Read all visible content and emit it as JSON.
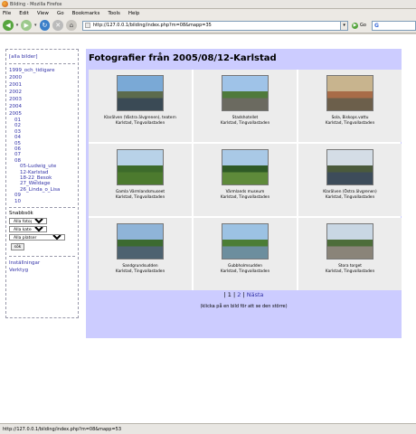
{
  "window": {
    "title": "Bilding - Mozilla Firefox"
  },
  "menu": [
    "File",
    "Edit",
    "View",
    "Go",
    "Bookmarks",
    "Tools",
    "Help"
  ],
  "toolbar": {
    "url": "http://127.0.0.1/bilding/index.php?m=08&mapp=35",
    "go_label": "Go"
  },
  "sidebar": {
    "all_images": "[alla bilder]",
    "years": [
      "1999_och_tidigare",
      "2000",
      "2001",
      "2002",
      "2003",
      "2004",
      "2005"
    ],
    "months": [
      "01",
      "02",
      "03",
      "04",
      "05",
      "06",
      "07",
      "08"
    ],
    "albums": [
      "05-Ludwig_ute",
      "12-Karlstad",
      "18-22_Besok",
      "27_Weldage",
      "26_Linda_o_Lisa"
    ],
    "months_after": [
      "09",
      "10"
    ],
    "quicksearch_label": "Snabbsök",
    "select_photographer": "Alla fotografer",
    "select_category": "Alla kategorier",
    "select_place": "Alla platser",
    "search_button": "sök",
    "settings": "Inställningar",
    "login": "Verktyg"
  },
  "main": {
    "title": "Fotografier från 2005/08/12-Karlstad",
    "photos": [
      {
        "cap1": "Klarälven (Västra älvgrenen), teatern",
        "cap2": "Karlstad, Tingvallastaden",
        "sky": "#7aa9d6",
        "ground": "#3a4a55",
        "mid": "#5c6b4d"
      },
      {
        "cap1": "Stadshotellet",
        "cap2": "Karlstad, Tingvallastaden",
        "sky": "#9fc3e8",
        "ground": "#6b6a60",
        "mid": "#4f7a3b"
      },
      {
        "cap1": "Sola, Biskops.vattu",
        "cap2": "Karlstad, Tingvallastaden",
        "sky": "#c8b48e",
        "ground": "#6c5f4b",
        "mid": "#a86c48"
      },
      {
        "cap1": "Gamla Värmlandsmuseet",
        "cap2": "Karlstad, Tingvallastaden",
        "sky": "#b8d2e8",
        "ground": "#4c7a2e",
        "mid": "#3d6b2b"
      },
      {
        "cap1": "Värmlands museum",
        "cap2": "Karlstad, Tingvallastaden",
        "sky": "#a9c9e6",
        "ground": "#5e8a3a",
        "mid": "#2f5a26"
      },
      {
        "cap1": "Klarälven (Östra älvgrenen)",
        "cap2": "Karlstad, Tingvallastaden",
        "sky": "#d4dde6",
        "ground": "#3d4c5a",
        "mid": "#4a5a3c"
      },
      {
        "cap1": "Sandgrundsudden",
        "cap2": "Karlstad, Tingvallastaden",
        "sky": "#8fb4d8",
        "ground": "#4d6270",
        "mid": "#3c6a30"
      },
      {
        "cap1": "Gubbholmsudden",
        "cap2": "Karlstad, Tingvallastaden",
        "sky": "#9cc2e3",
        "ground": "#6c8e9e",
        "mid": "#4c7d35"
      },
      {
        "cap1": "Stora torget",
        "cap2": "Karlstad, Tingvallastaden",
        "sky": "#c9d7e4",
        "ground": "#8a8479",
        "mid": "#4d6d3a"
      }
    ],
    "pager_prefix": "| 1 |",
    "pager_page2": "2",
    "pager_next": "Nästa",
    "hint": "(klicka på en bild för att se den större)"
  },
  "status": {
    "text": "http://127.0.0.1/bilding/index.php?m=08&mapp=53"
  }
}
